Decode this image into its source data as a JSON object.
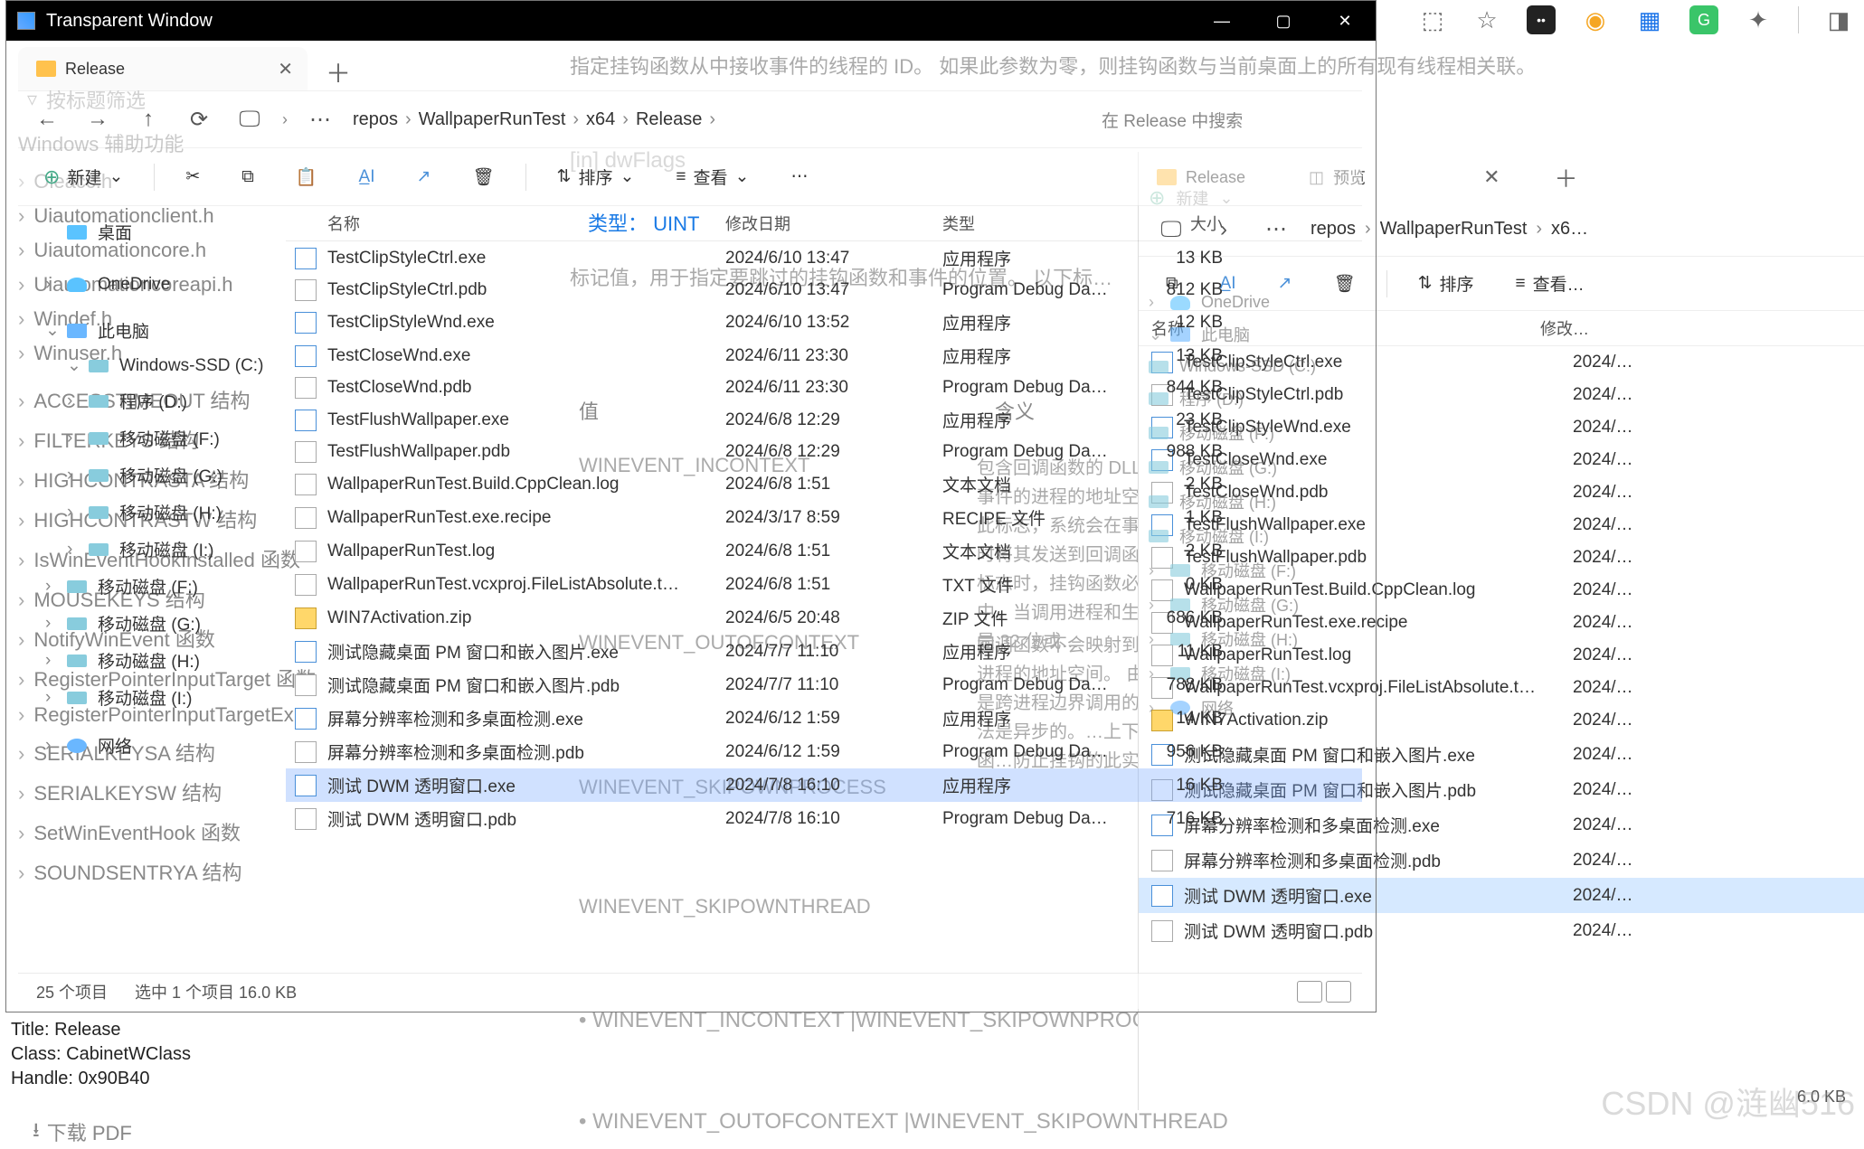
{
  "window": {
    "title": "Transparent Window",
    "buttons": {
      "min": "—",
      "max": "▢",
      "close": "✕"
    }
  },
  "info": {
    "title_line": "Title: Release",
    "class_line": "Class: CabinetWClass",
    "handle_line": "Handle: 0x90B40"
  },
  "bg": {
    "text1": "指定挂钩函数从中接收事件的线程的 ID。 如果此参数为零，则挂钩函数与当前桌面上的所有现有线程相关联。",
    "param": "[in]  dwFlags",
    "type": "类型：  UINT",
    "desc": "标记值，用于指定要跳过的挂钩函数和事件的位置。 以下标…",
    "lbl_value": "值",
    "lbl_meaning": "含义",
    "c1": "WINEVENT_INCONTEXT",
    "m1": "包含回调函数的 DLL 映射到生成事件的进程的地址空间中。 使用此标志，系统会在事件通知发生时将其发送到回调函数。 指定此标志时，挂钩函数必须位于 DLL 中。当调用进程和生成进程都不是 32 位或…",
    "c2": "WINEVENT_OUTOFCONTEXT",
    "m2": "回调函数不会映射到生成事件的进程的地址空间。 由于挂钩函数是跨进程边界调用的，因此…方法是异步的。…上下文外挂钩函…防止挂钩的此实…",
    "c3": "WINEVENT_SKIPOWNPROCESS",
    "c4": "WINEVENT_SKIPOWNTHREAD",
    "b1": "•  WINEVENT_INCONTEXT |WINEVENT_SKIPOWNPROCE…",
    "b2": "•  WINEVENT_OUTOFCONTEXT |WINEVENT_SKIPOWNTHREAD",
    "filter_ph": "按标题筛选",
    "heading": "Windows 辅助功能",
    "items": [
      "Oleacc.h",
      "Uiautomationclient.h",
      "Uiautomationcore.h",
      "Uiautomationcoreapi.h",
      "Windef.h",
      "Winuser.h"
    ],
    "items2": [
      "ACCESSTIMEOUT 结构",
      "FILTERKEYS 结构",
      "HIGHCONTRASTA 结构",
      "HIGHCONTRASTW 结构",
      "IsWinEventHookInstalled 函数",
      "MOUSEKEYS 结构",
      "NotifyWinEvent 函数",
      "RegisterPointerInputTarget 函数",
      "RegisterPointerInputTargetEx…",
      "SERIALKEYSA 结构",
      "SERIALKEYSW 结构",
      "SetWinEventHook 函数",
      "SOUNDSENTRYA 结构"
    ],
    "pdf": "下载 PDF"
  },
  "explorer1": {
    "tab": "Release",
    "crumbs": [
      "repos",
      "WallpaperRunTest",
      "x64",
      "Release"
    ],
    "search_ph": "在 Release 中搜索",
    "toolbar": {
      "new": "新建",
      "sort": "排序",
      "view": "查看"
    },
    "cols": {
      "name": "名称",
      "date": "修改日期",
      "type": "类型",
      "size": "大小"
    },
    "sidebar": {
      "desktop": "桌面",
      "onedrive": "OneDrive",
      "thispc": "此电脑",
      "ssd": "Windows-SSD (C:)",
      "d": "程序 (D:)",
      "f": "移动磁盘 (F:)",
      "g": "移动磁盘 (G:)",
      "h": "移动磁盘 (H:)",
      "i": "移动磁盘 (I:)",
      "f2": "移动磁盘 (F:)",
      "g2": "移动磁盘 (G:)",
      "h2": "移动磁盘 (H:)",
      "i2": "移动磁盘 (I:)",
      "net": "网络"
    },
    "files": [
      {
        "ico": "exe",
        "name": "TestClipStyleCtrl.exe",
        "date": "2024/6/10 13:47",
        "type": "应用程序",
        "size": "13 KB"
      },
      {
        "ico": "pdb",
        "name": "TestClipStyleCtrl.pdb",
        "date": "2024/6/10 13:47",
        "type": "Program Debug Da…",
        "size": "812 KB"
      },
      {
        "ico": "exe",
        "name": "TestClipStyleWnd.exe",
        "date": "2024/6/10 13:52",
        "type": "应用程序",
        "size": "12 KB"
      },
      {
        "ico": "exe",
        "name": "TestCloseWnd.exe",
        "date": "2024/6/11 23:30",
        "type": "应用程序",
        "size": "13 KB"
      },
      {
        "ico": "pdb",
        "name": "TestCloseWnd.pdb",
        "date": "2024/6/11 23:30",
        "type": "Program Debug Da…",
        "size": "844 KB"
      },
      {
        "ico": "exe",
        "name": "TestFlushWallpaper.exe",
        "date": "2024/6/8 12:29",
        "type": "应用程序",
        "size": "23 KB"
      },
      {
        "ico": "pdb",
        "name": "TestFlushWallpaper.pdb",
        "date": "2024/6/8 12:29",
        "type": "Program Debug Da…",
        "size": "988 KB"
      },
      {
        "ico": "log",
        "name": "WallpaperRunTest.Build.CppClean.log",
        "date": "2024/6/8 1:51",
        "type": "文本文档",
        "size": "2 KB"
      },
      {
        "ico": "recipe",
        "name": "WallpaperRunTest.exe.recipe",
        "date": "2024/3/17 8:59",
        "type": "RECIPE 文件",
        "size": "1 KB"
      },
      {
        "ico": "log",
        "name": "WallpaperRunTest.log",
        "date": "2024/6/8 1:51",
        "type": "文本文档",
        "size": "2 KB"
      },
      {
        "ico": "txt",
        "name": "WallpaperRunTest.vcxproj.FileListAbsolute.t…",
        "date": "2024/6/8 1:51",
        "type": "TXT 文件",
        "size": "0 KB"
      },
      {
        "ico": "zip",
        "name": "WIN7Activation.zip",
        "date": "2024/6/5 20:48",
        "type": "ZIP 文件",
        "size": "686 KB"
      },
      {
        "ico": "exe",
        "name": "测试隐藏桌面 PM 窗口和嵌入图片.exe",
        "date": "2024/7/7 11:10",
        "type": "应用程序",
        "size": "11 KB"
      },
      {
        "ico": "pdb",
        "name": "测试隐藏桌面 PM 窗口和嵌入图片.pdb",
        "date": "2024/7/7 11:10",
        "type": "Program Debug Da…",
        "size": "788 KB"
      },
      {
        "ico": "exe",
        "name": "屏幕分辨率检测和多桌面检测.exe",
        "date": "2024/6/12 1:59",
        "type": "应用程序",
        "size": "14 KB"
      },
      {
        "ico": "pdb",
        "name": "屏幕分辨率检测和多桌面检测.pdb",
        "date": "2024/6/12 1:59",
        "type": "Program Debug Da…",
        "size": "956 KB"
      },
      {
        "ico": "exe",
        "name": "测试 DWM 透明窗口.exe",
        "date": "2024/7/8 16:10",
        "type": "应用程序",
        "size": "16 KB",
        "selected": true
      },
      {
        "ico": "pdb",
        "name": "测试 DWM 透明窗口.pdb",
        "date": "2024/7/8 16:10",
        "type": "Program Debug Da…",
        "size": "716 KB"
      }
    ],
    "status": {
      "count": "25 个项目",
      "sel": "选中 1 个项目  16.0 KB"
    }
  },
  "ghost_right": {
    "new": "新建",
    "onedrive": "OneDrive",
    "thispc": "此电脑",
    "ssd": "Windows-SSD (C:)",
    "d": "程序 (D:)",
    "f": "移动磁盘 (F:)",
    "g": "移动磁盘 (G:)",
    "h": "移动磁盘 (H:)",
    "i": "移动磁盘 (I:)",
    "f2": "移动磁盘 (F:)",
    "g2": "移动磁盘 (G:)",
    "h2": "移动磁盘 (H:)",
    "i2": "移动磁盘 (I:)",
    "net": "网络"
  },
  "explorer2": {
    "tab": "Release",
    "preview": "预览",
    "crumbs": [
      "repos",
      "WallpaperRunTest",
      "x6…"
    ],
    "toolbar": {
      "sort": "排序",
      "view": "查看…"
    },
    "cols": {
      "name": "名称",
      "date": "修改…"
    },
    "files": [
      {
        "ico": "exe",
        "name": "TestClipStyleCtrl.exe",
        "date": "2024/…"
      },
      {
        "ico": "pdb",
        "name": "TestClipStyleCtrl.pdb",
        "date": "2024/…"
      },
      {
        "ico": "exe",
        "name": "TestClipStyleWnd.exe",
        "date": "2024/…"
      },
      {
        "ico": "exe",
        "name": "TestCloseWnd.exe",
        "date": "2024/…"
      },
      {
        "ico": "pdb",
        "name": "TestCloseWnd.pdb",
        "date": "2024/…"
      },
      {
        "ico": "exe",
        "name": "TestFlushWallpaper.exe",
        "date": "2024/…"
      },
      {
        "ico": "pdb",
        "name": "TestFlushWallpaper.pdb",
        "date": "2024/…"
      },
      {
        "ico": "log",
        "name": "WallpaperRunTest.Build.CppClean.log",
        "date": "2024/…"
      },
      {
        "ico": "recipe",
        "name": "WallpaperRunTest.exe.recipe",
        "date": "2024/…"
      },
      {
        "ico": "log",
        "name": "WallpaperRunTest.log",
        "date": "2024/…"
      },
      {
        "ico": "txt",
        "name": "WallpaperRunTest.vcxproj.FileListAbsolute.t…",
        "date": "2024/…"
      },
      {
        "ico": "zip",
        "name": "WIN7Activation.zip",
        "date": "2024/…"
      },
      {
        "ico": "exe",
        "name": "测试隐藏桌面 PM 窗口和嵌入图片.exe",
        "date": "2024/…"
      },
      {
        "ico": "pdb",
        "name": "测试隐藏桌面 PM 窗口和嵌入图片.pdb",
        "date": "2024/…"
      },
      {
        "ico": "exe",
        "name": "屏幕分辨率检测和多桌面检测.exe",
        "date": "2024/…"
      },
      {
        "ico": "pdb",
        "name": "屏幕分辨率检测和多桌面检测.pdb",
        "date": "2024/…"
      },
      {
        "ico": "exe",
        "name": "测试 DWM 透明窗口.exe",
        "date": "2024/…",
        "selected": true
      },
      {
        "ico": "pdb",
        "name": "测试 DWM 透明窗口.pdb",
        "date": "2024/…"
      }
    ],
    "status_sel": "6.0 KB"
  },
  "watermark": "CSDN @涟幽516"
}
